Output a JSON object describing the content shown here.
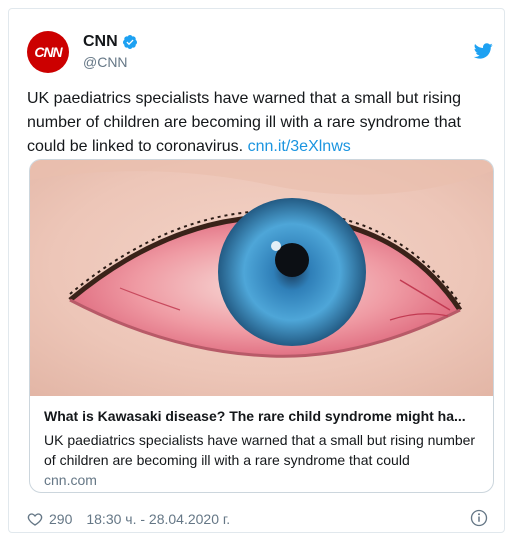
{
  "account": {
    "name": "CNN",
    "handle": "@CNN",
    "avatar_text": "CNN",
    "brand_color": "#cc0000"
  },
  "tweet": {
    "text": "UK paediatrics specialists have warned that a small but rising number of children are becoming ill with a rare syndrome that could be linked to coronavirus.",
    "link": "cnn.it/3eXlnws"
  },
  "link_card": {
    "title": "What is Kawasaki disease? The rare child syndrome might ha...",
    "description": "UK paediatrics specialists have warned that a small but rising number of children are becoming ill with a rare syndrome that could",
    "domain": "cnn.com",
    "image_icon": "red-eye-photo"
  },
  "footer": {
    "likes": "290",
    "timestamp": "18:30 ч. - 28.04.2020 г."
  },
  "icons": {
    "verified": "verified-badge-icon",
    "twitter": "twitter-bird-icon",
    "like": "heart-icon",
    "info": "info-icon"
  },
  "colors": {
    "link": "#1b95e0",
    "secondary": "#657786",
    "border": "#e1e8ed"
  }
}
